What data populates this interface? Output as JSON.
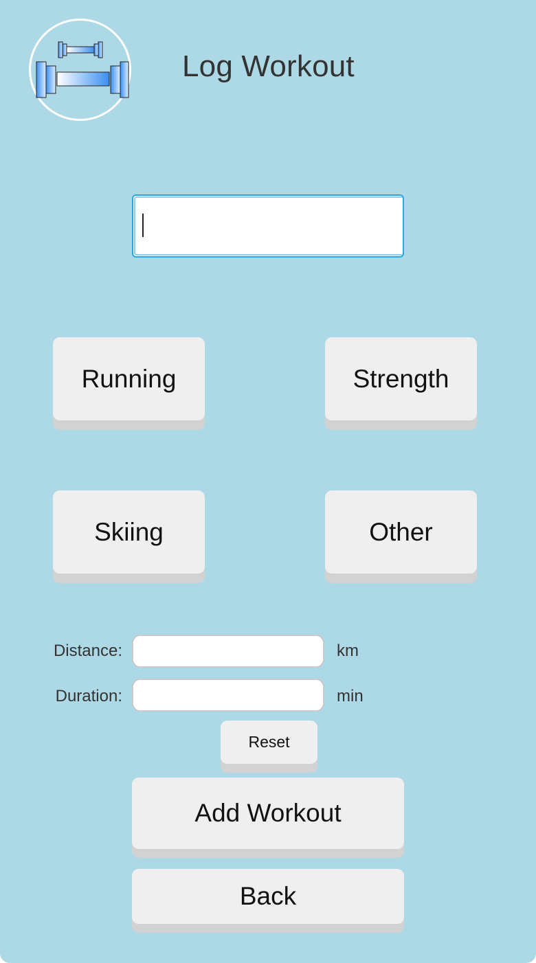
{
  "header": {
    "title": "Log Workout",
    "logo_icon": "dumbbell-icon"
  },
  "date_picker": {
    "value": "",
    "calendar_icon": "calendar-icon"
  },
  "workout_types": {
    "running": "Running",
    "strength": "Strength",
    "skiing": "Skiing",
    "other": "Other"
  },
  "form": {
    "distance_label": "Distance:",
    "distance_value": "",
    "distance_unit": "km",
    "duration_label": "Duration:",
    "duration_value": "",
    "duration_unit": "min"
  },
  "actions": {
    "reset": "Reset",
    "add_workout": "Add Workout",
    "back": "Back"
  },
  "colors": {
    "background": "#add8e6",
    "button": "#efefef",
    "button_shadow": "#d2d2d2",
    "focus_border": "#2aa7de"
  }
}
